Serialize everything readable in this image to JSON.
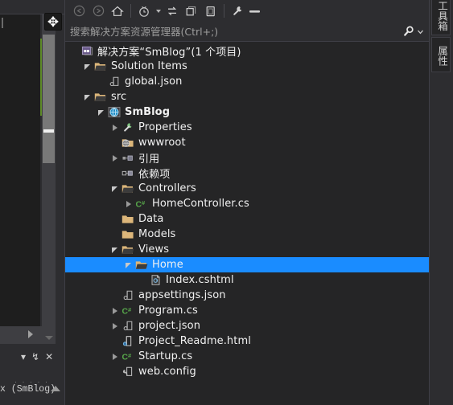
{
  "window": {
    "theme_bg": "#252526",
    "accent_selection": "#1a8cff",
    "changebar_green": "#5e8b28"
  },
  "toolbar": {
    "buttons": [
      {
        "name": "back-button",
        "icon": "back-arrow-icon",
        "glyph": "←",
        "enabled": false
      },
      {
        "name": "forward-button",
        "icon": "forward-arrow-icon",
        "glyph": "→",
        "enabled": false
      },
      {
        "name": "home-button",
        "icon": "home-icon",
        "glyph": "⌂",
        "enabled": true
      },
      {
        "name": "pending-changes-button",
        "icon": "clock-icon",
        "glyph": "◔",
        "enabled": true,
        "has_dropdown": true
      },
      {
        "name": "sync-with-active-document-button",
        "icon": "sync-arrows-icon",
        "glyph": "⇆",
        "enabled": true
      },
      {
        "name": "refresh-button",
        "icon": "copy-windows-icon",
        "glyph": "❐",
        "enabled": true
      },
      {
        "name": "show-all-files-button",
        "icon": "document-outline-icon",
        "glyph": "❑",
        "enabled": true
      },
      {
        "name": "properties-button",
        "icon": "wrench-icon",
        "glyph": "🔧",
        "enabled": true
      },
      {
        "name": "preview-selected-items-button",
        "icon": "dash-icon",
        "glyph": "➖",
        "enabled": true
      }
    ]
  },
  "search": {
    "placeholder": "搜索解决方案资源管理器(Ctrl+;)",
    "value": "",
    "search_icon": "magnifier-icon",
    "dropdown_icon": "chevron-down-icon"
  },
  "tree": {
    "items": [
      {
        "label": "解决方案“SmBlog”(1 个项目)",
        "depth": 0,
        "arrow": "none",
        "icon": "solution-icon",
        "bold": false,
        "selected": false
      },
      {
        "label": "Solution Items",
        "depth": 1,
        "arrow": "expanded",
        "icon": "folder-open-icon",
        "bold": false,
        "selected": false
      },
      {
        "label": "global.json",
        "depth": 2,
        "arrow": "none",
        "icon": "json-icon",
        "bold": false,
        "selected": false
      },
      {
        "label": "src",
        "depth": 1,
        "arrow": "expanded",
        "icon": "folder-open-icon",
        "bold": false,
        "selected": false
      },
      {
        "label": "SmBlog",
        "depth": 2,
        "arrow": "expanded",
        "icon": "web-project-icon",
        "bold": true,
        "selected": false
      },
      {
        "label": "Properties",
        "depth": 3,
        "arrow": "collapsed",
        "icon": "wrench-icon",
        "bold": false,
        "selected": false
      },
      {
        "label": "wwwroot",
        "depth": 3,
        "arrow": "none",
        "icon": "wwwroot-icon",
        "bold": false,
        "selected": false
      },
      {
        "label": "引用",
        "depth": 3,
        "arrow": "collapsed",
        "icon": "references-icon",
        "bold": false,
        "selected": false
      },
      {
        "label": "依赖项",
        "depth": 3,
        "arrow": "none",
        "icon": "dependencies-icon",
        "bold": false,
        "selected": false
      },
      {
        "label": "Controllers",
        "depth": 3,
        "arrow": "expanded",
        "icon": "folder-open-icon",
        "bold": false,
        "selected": false
      },
      {
        "label": "HomeController.cs",
        "depth": 4,
        "arrow": "collapsed",
        "icon": "csharp-icon",
        "bold": false,
        "selected": false
      },
      {
        "label": "Data",
        "depth": 3,
        "arrow": "none",
        "icon": "folder-closed-icon",
        "bold": false,
        "selected": false
      },
      {
        "label": "Models",
        "depth": 3,
        "arrow": "none",
        "icon": "folder-closed-icon",
        "bold": false,
        "selected": false
      },
      {
        "label": "Views",
        "depth": 3,
        "arrow": "expanded",
        "icon": "folder-open-icon",
        "bold": false,
        "selected": false
      },
      {
        "label": "Home",
        "depth": 4,
        "arrow": "expanded",
        "icon": "folder-open-icon",
        "bold": false,
        "selected": true
      },
      {
        "label": "Index.cshtml",
        "depth": 5,
        "arrow": "none",
        "icon": "cshtml-icon",
        "bold": false,
        "selected": false
      },
      {
        "label": "appsettings.json",
        "depth": 3,
        "arrow": "none",
        "icon": "json-icon",
        "bold": false,
        "selected": false
      },
      {
        "label": "Program.cs",
        "depth": 3,
        "arrow": "collapsed",
        "icon": "csharp-icon",
        "bold": false,
        "selected": false
      },
      {
        "label": "project.json",
        "depth": 3,
        "arrow": "collapsed",
        "icon": "json-icon",
        "bold": false,
        "selected": false
      },
      {
        "label": "Project_Readme.html",
        "depth": 3,
        "arrow": "none",
        "icon": "html-icon",
        "bold": false,
        "selected": false
      },
      {
        "label": "Startup.cs",
        "depth": 3,
        "arrow": "collapsed",
        "icon": "csharp-icon",
        "bold": false,
        "selected": false
      },
      {
        "label": "web.config",
        "depth": 3,
        "arrow": "none",
        "icon": "config-icon",
        "bold": false,
        "selected": false
      }
    ]
  },
  "left_pane": {
    "tool_icons": [
      {
        "name": "window-dropdown-button",
        "icon": "chevron-down-icon",
        "glyph": "▾"
      },
      {
        "name": "pin-window-button",
        "icon": "pin-icon",
        "glyph": "↯"
      },
      {
        "name": "close-window-button",
        "icon": "close-icon",
        "glyph": "✕"
      }
    ],
    "status_text": "x (SmBlog)",
    "dots_text": "· · · · ·",
    "scroll_up_icon": "scroll-up-arrow-icon",
    "scroll_down_icon": "scroll-down-arrow-icon",
    "hscroll_right_icon": "scroll-right-arrow-icon",
    "resize_cursor_glyph": "✥",
    "expand_up_icon": "expand-up-arrow-icon"
  },
  "right_strip": {
    "tabs": [
      {
        "label": "工具箱",
        "name": "vertical-tab-toolbox"
      },
      {
        "label": "属性",
        "name": "vertical-tab-properties"
      }
    ]
  }
}
